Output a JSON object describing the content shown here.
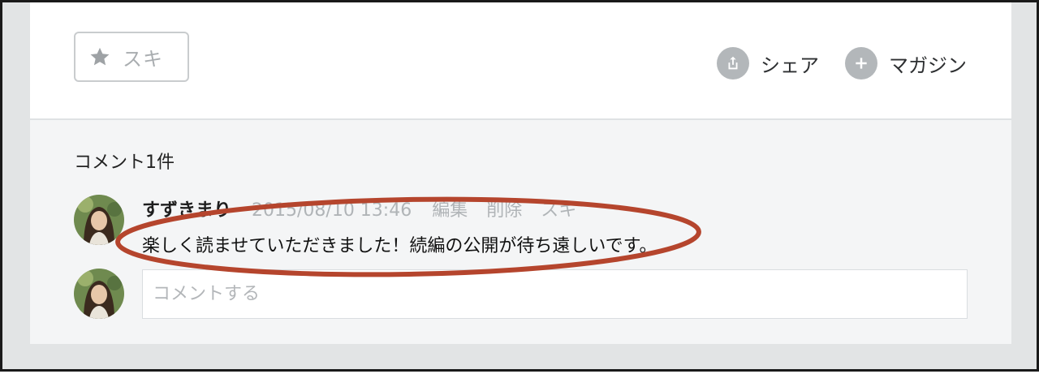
{
  "like_button": {
    "label": "スキ",
    "icon": "star-icon"
  },
  "actions": {
    "share": {
      "label": "シェア",
      "icon": "share-icon"
    },
    "magazine": {
      "label": "マガジン",
      "icon": "plus-icon"
    }
  },
  "comments": {
    "count_label": "コメント1件",
    "items": [
      {
        "author": "すずきまり",
        "date": "2015/08/10 13:46",
        "actions": [
          "編集",
          "削除",
          "スキ"
        ],
        "body": "楽しく読ませていただきました！続編の公開が待ち遠しいです。"
      }
    ],
    "input_placeholder": "コメントする"
  },
  "colors": {
    "highlight": "#b5452d",
    "icon_gray": "#b3b7ba",
    "panel": "#f4f5f6"
  }
}
